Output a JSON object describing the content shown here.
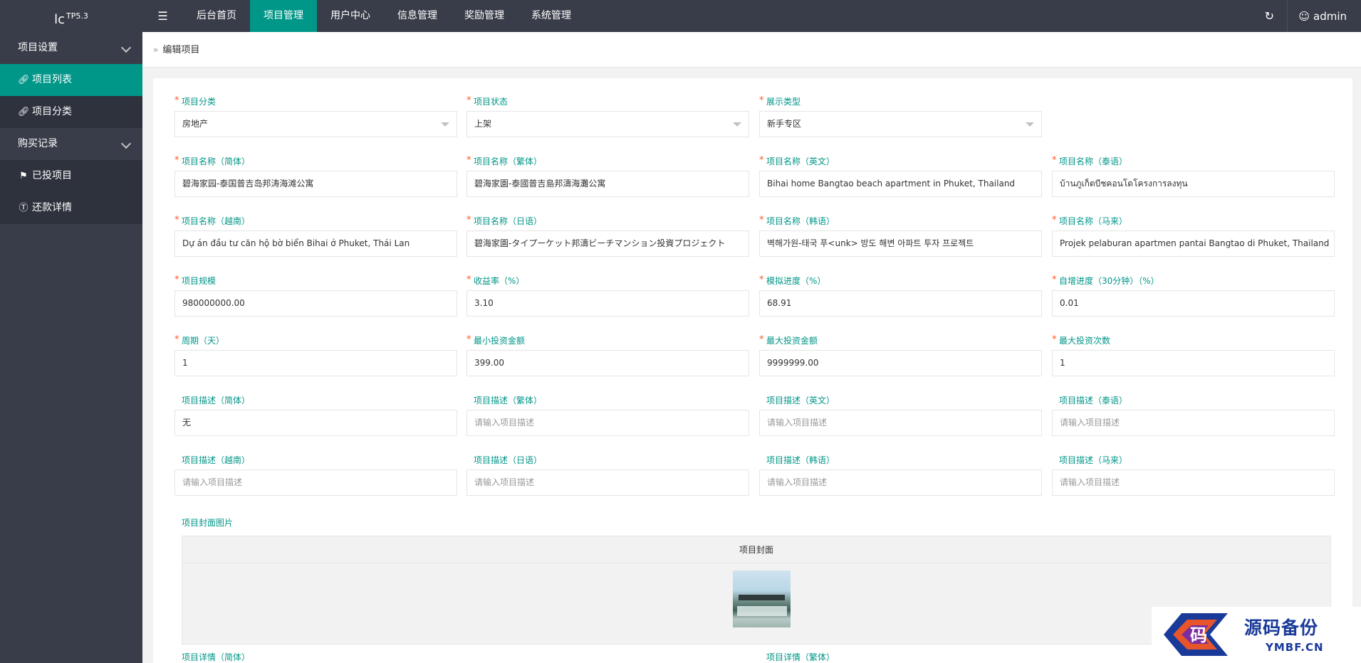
{
  "app": {
    "logo": "lc",
    "version": "TP5.3"
  },
  "sidebar": {
    "items": [
      {
        "label": "项目设置",
        "icon": "none",
        "expandable": true,
        "level": 1
      },
      {
        "label": "项目列表",
        "icon": "link-icon",
        "active": true,
        "level": 2
      },
      {
        "label": "项目分类",
        "icon": "link-icon",
        "level": 2
      },
      {
        "label": "购买记录",
        "icon": "none",
        "expandable": true,
        "level": 1
      },
      {
        "label": "已投项目",
        "icon": "flag-icon",
        "level": 2
      },
      {
        "label": "还款详情",
        "icon": "dollar-icon",
        "level": 2
      }
    ]
  },
  "topbar": {
    "menu_toggle_icon": "menu-icon",
    "tabs": [
      "后台首页",
      "项目管理",
      "用户中心",
      "信息管理",
      "奖励管理",
      "系统管理"
    ],
    "active_tab": "项目管理",
    "refresh_icon": "refresh-icon",
    "user_icon": "user-icon",
    "username": "admin"
  },
  "breadcrumb": {
    "current": "编辑项目"
  },
  "form": {
    "category": {
      "label": "项目分类",
      "value": "房地产",
      "required": true
    },
    "status": {
      "label": "项目状态",
      "value": "上架",
      "required": true
    },
    "display_type": {
      "label": "展示类型",
      "value": "新手专区",
      "required": true
    },
    "name_zh_cn": {
      "label": "项目名称（简体）",
      "value": "碧海家园-泰国普吉岛邦涛海滩公寓",
      "required": true
    },
    "name_zh_tw": {
      "label": "项目名称（繁体）",
      "value": "碧海家園-泰國普吉島邦濤海灘公寓",
      "required": true
    },
    "name_en": {
      "label": "项目名称（英文）",
      "value": "Bihai home Bangtao beach apartment in Phuket, Thailand",
      "required": true
    },
    "name_th": {
      "label": "项目名称（泰语）",
      "value": "บ้านภูเก็ตบีชคอนโดโครงการลงทุน",
      "required": true
    },
    "name_vi": {
      "label": "项目名称（越南）",
      "value": "Dự án đầu tư căn hộ bờ biển Bihai ở Phuket, Thái Lan",
      "required": true
    },
    "name_ja": {
      "label": "项目名称（日语）",
      "value": "碧海家園-タイプーケット邦濤ビーチマンション投資プロジェクト",
      "required": true
    },
    "name_ko": {
      "label": "项目名称（韩语）",
      "value": "벽해가원-태국 푸<unk> 방도 해변 아파트 투자 프로젝트",
      "required": true
    },
    "name_ms": {
      "label": "项目名称（马来）",
      "value": "Projek pelaburan apartmen pantai Bangtao di Phuket, Thailand",
      "required": true
    },
    "scale": {
      "label": "项目规模",
      "value": "980000000.00",
      "required": true
    },
    "yield": {
      "label": "收益率（%）",
      "value": "3.10",
      "required": true
    },
    "sim_progress": {
      "label": "模拟进度（%）",
      "value": "68.91",
      "required": true
    },
    "auto_progress": {
      "label": "自增进度（30分钟）（%）",
      "value": "0.01",
      "required": true
    },
    "period": {
      "label": "周期（天）",
      "value": "1",
      "required": true
    },
    "min_invest": {
      "label": "最小投资金额",
      "value": "399.00",
      "required": true
    },
    "max_invest": {
      "label": "最大投资金额",
      "value": "9999999.00",
      "required": true
    },
    "max_times": {
      "label": "最大投资次数",
      "value": "1",
      "required": true
    },
    "desc_zh_cn": {
      "label": "项目描述（简体）",
      "value": "无",
      "placeholder": "请输入项目描述"
    },
    "desc_zh_tw": {
      "label": "项目描述（繁体）",
      "value": "",
      "placeholder": "请输入项目描述"
    },
    "desc_en": {
      "label": "项目描述（英文）",
      "value": "",
      "placeholder": "请输入项目描述"
    },
    "desc_th": {
      "label": "项目描述（泰语）",
      "value": "",
      "placeholder": "请输入项目描述"
    },
    "desc_vi": {
      "label": "项目描述（越南）",
      "value": "",
      "placeholder": "请输入项目描述"
    },
    "desc_ja": {
      "label": "项目描述（日语）",
      "value": "",
      "placeholder": "请输入项目描述"
    },
    "desc_ko": {
      "label": "项目描述（韩语）",
      "value": "",
      "placeholder": "请输入项目描述"
    },
    "desc_ms": {
      "label": "项目描述（马来）",
      "value": "",
      "placeholder": "请输入项目描述"
    },
    "cover": {
      "label": "项目封面图片",
      "header": "项目封面"
    },
    "detail_zh_cn": {
      "label": "项目详情（简体）"
    },
    "detail_zh_tw": {
      "label": "项目详情（繁体）"
    }
  },
  "watermark": {
    "title": "源码备份",
    "site": "YMBF.CN",
    "badge_char": "码"
  },
  "colors": {
    "accent": "#009688",
    "sidebar_bg": "#393d49",
    "required": "#ff5722"
  }
}
